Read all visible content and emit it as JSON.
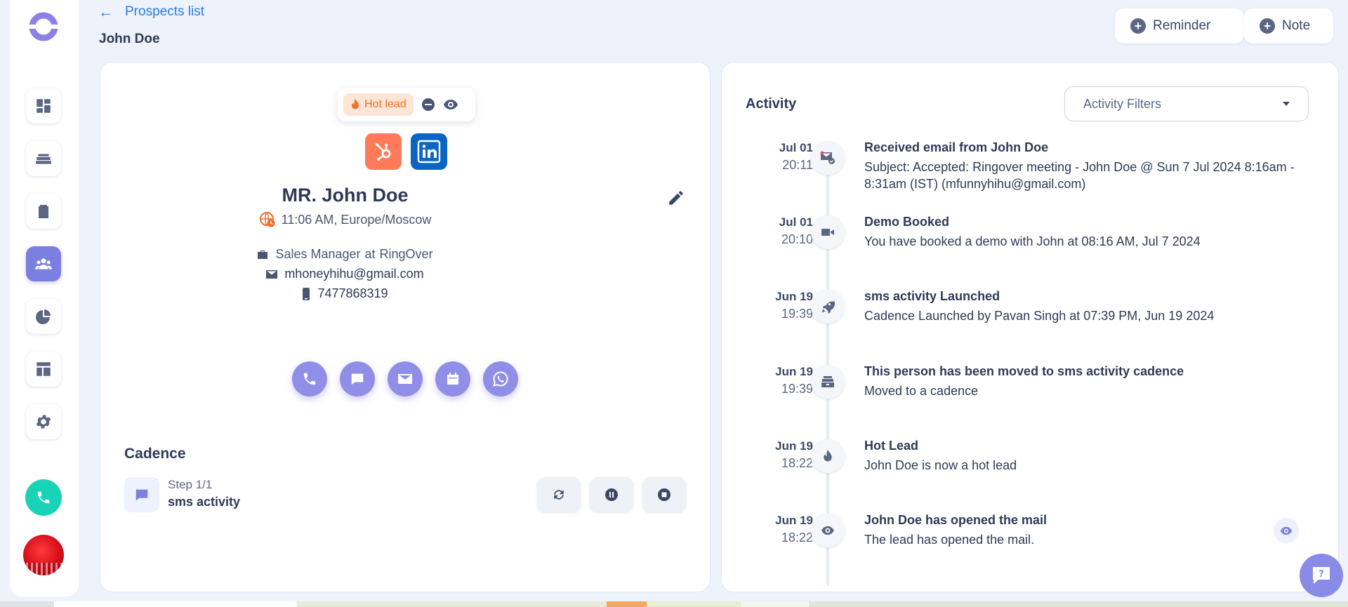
{
  "header": {
    "back_label": "Prospects list",
    "page_title": "John Doe",
    "reminder_label": "Reminder",
    "note_label": "Note"
  },
  "sidebar": {
    "items": [
      {
        "name": "dashboard",
        "icon": "dashboard-icon"
      },
      {
        "name": "inbox",
        "icon": "inbox-icon"
      },
      {
        "name": "tasks",
        "icon": "clipboard-icon"
      },
      {
        "name": "prospects",
        "icon": "people-icon",
        "active": true
      },
      {
        "name": "reports",
        "icon": "pie-chart-icon"
      },
      {
        "name": "templates",
        "icon": "layout-icon"
      },
      {
        "name": "settings",
        "icon": "gear-icon"
      }
    ]
  },
  "prospect": {
    "lead_tag": "Hot lead",
    "name": "MR. John Doe",
    "local_time": "11:06 AM, Europe/Moscow",
    "role": "Sales Manager",
    "at": "at",
    "company": "RingOver",
    "email": "mhoneyhihu@gmail.com",
    "phone": "7477868319"
  },
  "cadence": {
    "title": "Cadence",
    "step": "Step 1/1",
    "name": "sms activity"
  },
  "activity": {
    "title": "Activity",
    "filter_placeholder": "Activity Filters",
    "items": [
      {
        "date": "Jul 01",
        "time": "20:11",
        "icon": "mail-received-icon",
        "title": "Received email from John Doe",
        "desc": "Subject: Accepted: Ringover meeting - John Doe @ Sun 7 Jul 2024 8:16am - 8:31am (IST) (mfunnyhihu@gmail.com)"
      },
      {
        "date": "Jul 01",
        "time": "20:10",
        "icon": "video-icon",
        "title": "Demo Booked",
        "desc": "You have booked a demo with John at 08:16 AM, Jul 7 2024"
      },
      {
        "date": "Jun 19",
        "time": "19:39",
        "icon": "rocket-icon",
        "title": "sms activity Launched",
        "desc": "Cadence Launched by Pavan Singh at 07:39 PM, Jun 19 2024"
      },
      {
        "date": "Jun 19",
        "time": "19:39",
        "icon": "cadence-icon",
        "title": "This person has been moved to sms activity cadence",
        "desc": "Moved to a cadence"
      },
      {
        "date": "Jun 19",
        "time": "18:22",
        "icon": "fire-icon",
        "title": "Hot Lead",
        "desc": "John Doe is now a hot lead"
      },
      {
        "date": "Jun 19",
        "time": "18:22",
        "icon": "eye-icon",
        "title": "John Doe has opened the mail",
        "desc": "The lead has opened the mail."
      }
    ]
  },
  "colors": {
    "accent": "#2a7de1",
    "primary_purple": "#8f8fe8",
    "hot": "#f06f2c",
    "teal": "#18d3b5"
  }
}
